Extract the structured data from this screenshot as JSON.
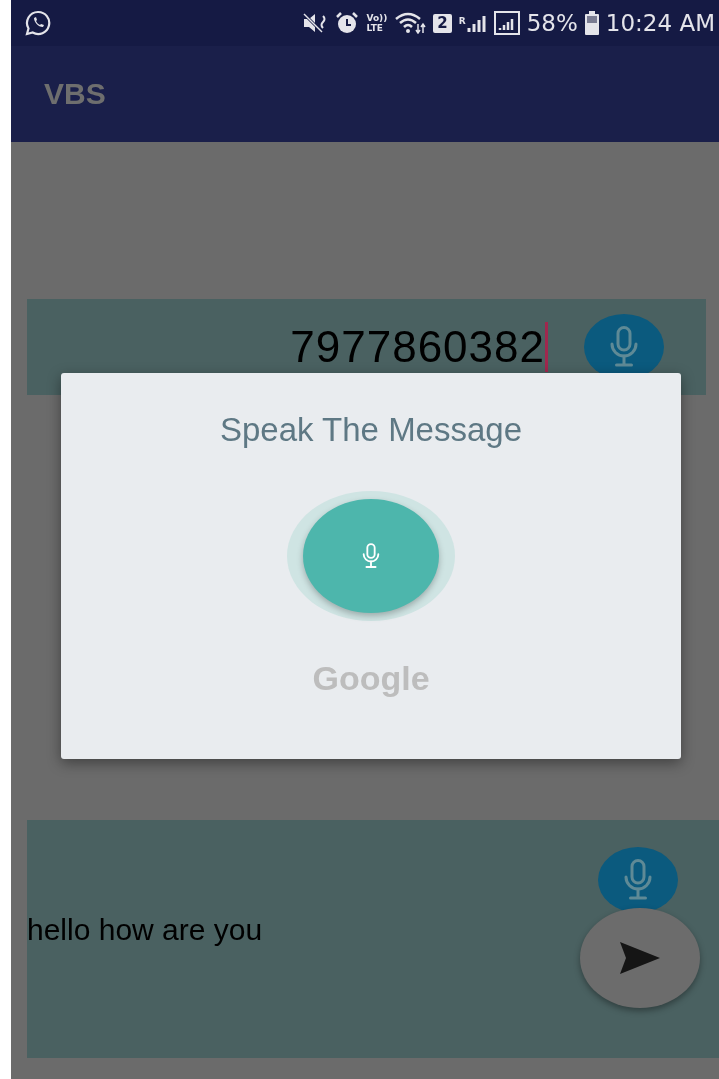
{
  "status_bar": {
    "volte_top": "Vo))",
    "volte_bottom": "LTE",
    "sim_badge": "2",
    "roaming": "R",
    "battery": "58%",
    "time": "10:24 AM"
  },
  "app_bar": {
    "title": "VBS"
  },
  "phone_field": {
    "value": "7977860382",
    "focused": true
  },
  "message_field": {
    "value": "hello how are you"
  },
  "dialog": {
    "title": "Speak The Message",
    "brand": "Google"
  }
}
